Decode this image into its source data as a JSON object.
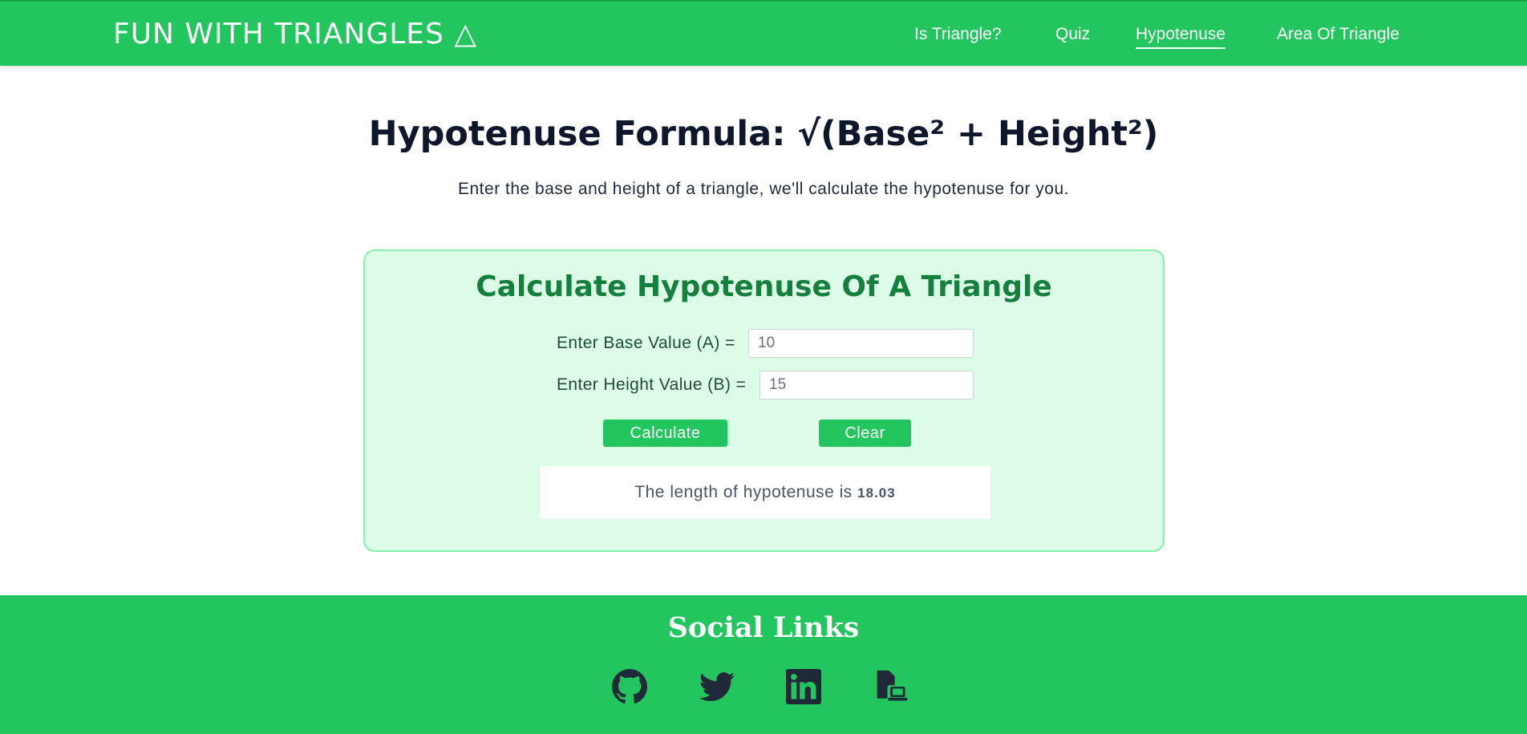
{
  "header": {
    "brand": "FUN WITH TRIANGLES △",
    "nav": [
      {
        "label": "Is Triangle?",
        "active": false
      },
      {
        "label": "Quiz",
        "active": false
      },
      {
        "label": "Hypotenuse",
        "active": true
      },
      {
        "label": "Area Of Triangle",
        "active": false
      }
    ]
  },
  "main": {
    "title": "Hypotenuse Formula: √(Base² + Height²)",
    "description": "Enter the base and height of a triangle, we'll calculate the hypotenuse for you.",
    "card": {
      "title": "Calculate Hypotenuse Of A Triangle",
      "base_label": "Enter Base Value (A) =",
      "base_value": "10",
      "height_label": "Enter Height Value (B) =",
      "height_value": "15",
      "calculate_label": "Calculate",
      "clear_label": "Clear",
      "result_text": "The length of hypotenuse is",
      "result_value": "18.03"
    }
  },
  "footer": {
    "title": "Social Links",
    "icons": [
      "github-icon",
      "twitter-icon",
      "linkedin-icon",
      "portfolio-icon"
    ]
  },
  "colors": {
    "primary_green": "#22c55e",
    "card_background": "#dcfce7",
    "card_border": "#86efac",
    "card_title": "#15803d"
  }
}
